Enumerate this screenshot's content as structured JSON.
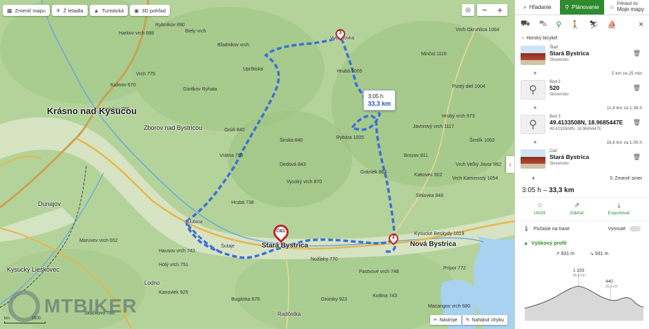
{
  "map_toolbar": [
    {
      "name": "change-map-button",
      "icon": "map-icon",
      "label": "Zmeniť mapu"
    },
    {
      "name": "airport-button",
      "icon": "plane-icon",
      "label": "Ž letadla"
    },
    {
      "name": "tourist-button",
      "icon": "mountain-icon",
      "label": "Turistická"
    },
    {
      "name": "3d-view-button",
      "icon": "globe-icon",
      "label": "3D pohľad"
    }
  ],
  "zoom": {
    "in": "+",
    "out": "−",
    "locate": "◎"
  },
  "route_tip": {
    "time": "3:05 h",
    "distance": "33,3 km"
  },
  "markers": {
    "wp3": "3",
    "wp2": "2",
    "end": "CIEĽ"
  },
  "towns": {
    "krasno": "Krásno nad Kysucou",
    "zborov": "Zborov nad Bystricou",
    "stara": "Stará Bystrica",
    "nova": "Nová Bystrica",
    "dunajov": "Dunajov",
    "kysucky": "Kysucký Lieskovec",
    "lodno": "Lodno",
    "radostka": "Radôstka",
    "klubina": "Klubina",
    "vychylovka": "Vychylovka",
    "sulaje": "Šutaje"
  },
  "peaks": [
    "Harkov vrch 688",
    "Rybníkov 890",
    "Bľadnikov vrch",
    "Biely vrch",
    "Uprštiská",
    "Gorilkov Ryhala",
    "Vrch 775",
    "Kalinov 670",
    "Latiakov 865",
    "Široká 840",
    "Vrátna 758",
    "Grúň 840",
    "Dedová 843",
    "Vysoký vrch 870",
    "Hrubá 1005",
    "Rybára 1005",
    "Grániek 864",
    "Brezov 811",
    "Sihlovka 849",
    "Minčol 1116",
    "Pustý diel 1004",
    "Javorový vrch 1117",
    "Hrubý vrch 973",
    "Vrch Okruhlica 1064",
    "Vrch Kamenistý 1054",
    "Šimlík 1002",
    "Kakovec 902",
    "Vrch Veľký Javor 962",
    "Kysucké Beskydy 1019",
    "Pastvové vrch 748",
    "Nožlahy 770",
    "Bugánka 678",
    "Skáčkovo 786",
    "Prípor 772",
    "Maruvov vrch 652",
    "Hrubá 738",
    "Macangov vrch 680",
    "Hausov vrch 743",
    "Kotlina 743",
    "Kanoviek 925",
    "Grúniky 923",
    "Holý vrch 751"
  ],
  "logo": "MTBIKER",
  "bottom_tools": [
    {
      "name": "tools-button",
      "icon": "wrench-icon",
      "label": "Nástroje"
    },
    {
      "name": "report-error-button",
      "icon": "pencil-icon",
      "label": "Nahlásiť chybu"
    }
  ],
  "scale": {
    "left": "km",
    "right": "1500"
  },
  "panel": {
    "tabs": [
      {
        "name": "tab-search",
        "icon": "search-icon",
        "label": "Hľadanie"
      },
      {
        "name": "tab-planning",
        "icon": "bike-icon",
        "label": "Plánovanie"
      },
      {
        "name": "tab-my-maps",
        "icon": "star-icon",
        "label_small": "Prihlásiť do",
        "label": "Moje mapy"
      }
    ],
    "modes": [
      {
        "name": "car-mode-icon",
        "glyph": "⛟"
      },
      {
        "name": "bus-mode-icon",
        "glyph": "⛍"
      },
      {
        "name": "bike-mode-icon",
        "glyph": "⚲"
      },
      {
        "name": "walk-mode-icon",
        "glyph": "🚶"
      },
      {
        "name": "ski-mode-icon",
        "glyph": "⛷"
      },
      {
        "name": "boat-mode-icon",
        "glyph": "⛵"
      }
    ],
    "close": "×",
    "profile_label": "Horský bicykel",
    "stops": [
      {
        "role": "Štart",
        "title": "Stará Bystrica",
        "sub": "Slovensko",
        "thumb": "img"
      },
      {
        "role": "Bod 2",
        "title": "520",
        "sub": "Slovensko",
        "thumb": "pin"
      },
      {
        "role": "Bod 3",
        "title": "49.4133508N, 18.9685447E",
        "sub": "49.4133508N, 18.9685447E",
        "thumb": "pin"
      },
      {
        "role": "Cieľ",
        "title": "Stará Bystrica",
        "sub": "Slovensko",
        "thumb": "img"
      }
    ],
    "segments": [
      "5 km za 25 min",
      "11,6 km za 1:36 h",
      "16,6 km za 1:05 h"
    ],
    "swap_label": "Zmeniť smer",
    "summary_time": "3:05 h",
    "summary_dist": "33,3 km",
    "actions": [
      {
        "name": "save-button",
        "icon": "☆",
        "label": "Uložiť"
      },
      {
        "name": "share-button",
        "icon": "⇗",
        "label": "Zdieľať"
      },
      {
        "name": "export-button",
        "icon": "⤓",
        "label": "Exportovať"
      }
    ],
    "weather_label": "Počasie na trase",
    "weather_toggle": "Vynnuté",
    "elevation_title": "Výškový profil",
    "elev_up": "931 m",
    "elev_down": "931 m",
    "elev_max": "1 233",
    "elev_min": "440",
    "elev_max_sub": "86,4 km",
    "elev_min_sub": "32,9 km"
  }
}
